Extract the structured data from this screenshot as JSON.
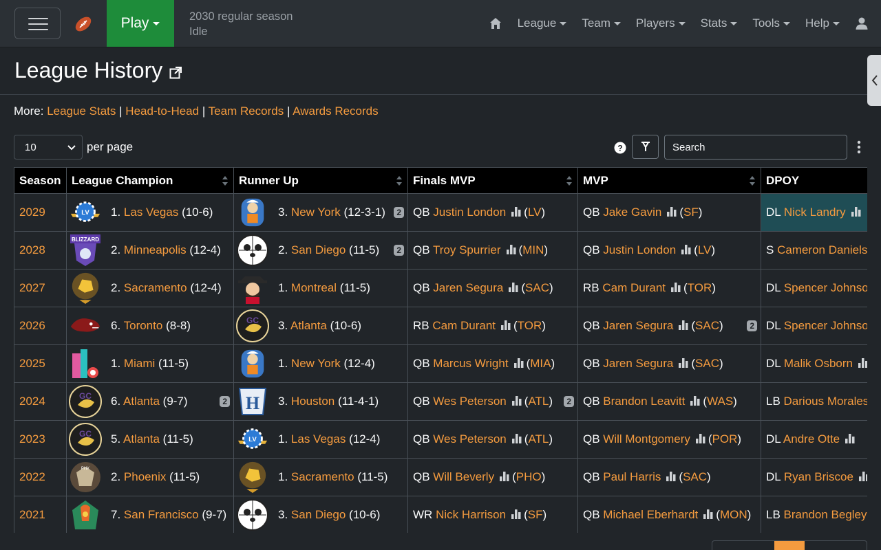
{
  "nav": {
    "play_label": "Play",
    "season": "2030 regular season",
    "status": "Idle",
    "menus": [
      "League",
      "Team",
      "Players",
      "Stats",
      "Tools",
      "Help"
    ]
  },
  "page": {
    "title": "League History"
  },
  "more": {
    "prefix": "More:",
    "links": [
      "League Stats",
      "Head-to-Head",
      "Team Records",
      "Awards Records"
    ],
    "sep": "|"
  },
  "controls": {
    "per_page_value": "10",
    "per_page_label": "per page",
    "search_placeholder": "Search"
  },
  "table": {
    "headers": [
      "Season",
      "League Champion",
      "Runner Up",
      "Finals MVP",
      "MVP",
      "DPOY"
    ],
    "rows": [
      {
        "season": "2029",
        "champ_seed": "1.",
        "champ": "Las Vegas",
        "champ_rec": "(10-6)",
        "champ_badge": "",
        "ru_seed": "3.",
        "ru": "New York",
        "ru_rec": "(12-3-1)",
        "ru_badge": "2",
        "fmvp_pos": "QB",
        "fmvp": "Justin London",
        "fmvp_team": "LV",
        "fmvp_badge": "",
        "mvp_pos": "QB",
        "mvp": "Jake Gavin",
        "mvp_team": "SF",
        "mvp_badge": "",
        "dpoy_pos": "DL",
        "dpoy": "Nick Landry",
        "champ_logo": "lv",
        "ru_logo": "ny"
      },
      {
        "season": "2028",
        "champ_seed": "2.",
        "champ": "Minneapolis",
        "champ_rec": "(12-4)",
        "champ_badge": "",
        "ru_seed": "2.",
        "ru": "San Diego",
        "ru_rec": "(11-5)",
        "ru_badge": "2",
        "fmvp_pos": "QB",
        "fmvp": "Troy Spurrier",
        "fmvp_team": "MIN",
        "fmvp_badge": "",
        "mvp_pos": "QB",
        "mvp": "Justin London",
        "mvp_team": "LV",
        "mvp_badge": "",
        "dpoy_pos": "S",
        "dpoy": "Cameron Daniels",
        "champ_logo": "min",
        "ru_logo": "sd"
      },
      {
        "season": "2027",
        "champ_seed": "2.",
        "champ": "Sacramento",
        "champ_rec": "(12-4)",
        "champ_badge": "",
        "ru_seed": "1.",
        "ru": "Montreal",
        "ru_rec": "(11-5)",
        "ru_badge": "",
        "fmvp_pos": "QB",
        "fmvp": "Jaren Segura",
        "fmvp_team": "SAC",
        "fmvp_badge": "",
        "mvp_pos": "RB",
        "mvp": "Cam Durant",
        "mvp_team": "TOR",
        "mvp_badge": "",
        "dpoy_pos": "DL",
        "dpoy": "Spencer Johnson",
        "champ_logo": "sac",
        "ru_logo": "mon"
      },
      {
        "season": "2026",
        "champ_seed": "6.",
        "champ": "Toronto",
        "champ_rec": "(8-8)",
        "champ_badge": "",
        "ru_seed": "3.",
        "ru": "Atlanta",
        "ru_rec": "(10-6)",
        "ru_badge": "",
        "fmvp_pos": "RB",
        "fmvp": "Cam Durant",
        "fmvp_team": "TOR",
        "fmvp_badge": "",
        "mvp_pos": "QB",
        "mvp": "Jaren Segura",
        "mvp_team": "SAC",
        "mvp_badge": "2",
        "dpoy_pos": "DL",
        "dpoy": "Spencer Johnson",
        "champ_logo": "tor",
        "ru_logo": "atl"
      },
      {
        "season": "2025",
        "champ_seed": "1.",
        "champ": "Miami",
        "champ_rec": "(11-5)",
        "champ_badge": "",
        "ru_seed": "1.",
        "ru": "New York",
        "ru_rec": "(12-4)",
        "ru_badge": "",
        "fmvp_pos": "QB",
        "fmvp": "Marcus Wright",
        "fmvp_team": "MIA",
        "fmvp_badge": "",
        "mvp_pos": "QB",
        "mvp": "Jaren Segura",
        "mvp_team": "SAC",
        "mvp_badge": "",
        "dpoy_pos": "DL",
        "dpoy": "Malik Osborn",
        "champ_logo": "mia",
        "ru_logo": "ny"
      },
      {
        "season": "2024",
        "champ_seed": "6.",
        "champ": "Atlanta",
        "champ_rec": "(9-7)",
        "champ_badge": "2",
        "ru_seed": "3.",
        "ru": "Houston",
        "ru_rec": "(11-4-1)",
        "ru_badge": "",
        "fmvp_pos": "QB",
        "fmvp": "Wes Peterson",
        "fmvp_team": "ATL",
        "fmvp_badge": "2",
        "mvp_pos": "QB",
        "mvp": "Brandon Leavitt",
        "mvp_team": "WAS",
        "mvp_badge": "",
        "dpoy_pos": "LB",
        "dpoy": "Darious Morales",
        "champ_logo": "atl",
        "ru_logo": "hou"
      },
      {
        "season": "2023",
        "champ_seed": "5.",
        "champ": "Atlanta",
        "champ_rec": "(11-5)",
        "champ_badge": "",
        "ru_seed": "1.",
        "ru": "Las Vegas",
        "ru_rec": "(12-4)",
        "ru_badge": "",
        "fmvp_pos": "QB",
        "fmvp": "Wes Peterson",
        "fmvp_team": "ATL",
        "fmvp_badge": "",
        "mvp_pos": "QB",
        "mvp": "Will Montgomery",
        "mvp_team": "POR",
        "mvp_badge": "",
        "dpoy_pos": "DL",
        "dpoy": "Andre Otte",
        "champ_logo": "atl",
        "ru_logo": "lv"
      },
      {
        "season": "2022",
        "champ_seed": "2.",
        "champ": "Phoenix",
        "champ_rec": "(11-5)",
        "champ_badge": "",
        "ru_seed": "1.",
        "ru": "Sacramento",
        "ru_rec": "(11-5)",
        "ru_badge": "",
        "fmvp_pos": "QB",
        "fmvp": "Will Beverly",
        "fmvp_team": "PHO",
        "fmvp_badge": "",
        "mvp_pos": "QB",
        "mvp": "Paul Harris",
        "mvp_team": "SAC",
        "mvp_badge": "",
        "dpoy_pos": "DL",
        "dpoy": "Ryan Briscoe",
        "champ_logo": "pho",
        "ru_logo": "sac"
      },
      {
        "season": "2021",
        "champ_seed": "7.",
        "champ": "San Francisco",
        "champ_rec": "(9-7)",
        "champ_badge": "",
        "ru_seed": "3.",
        "ru": "San Diego",
        "ru_rec": "(10-6)",
        "ru_badge": "",
        "fmvp_pos": "WR",
        "fmvp": "Nick Harrison",
        "fmvp_team": "SF",
        "fmvp_badge": "",
        "mvp_pos": "QB",
        "mvp": "Michael Eberhardt",
        "mvp_team": "MON",
        "mvp_badge": "",
        "dpoy_pos": "LB",
        "dpoy": "Brandon Begley",
        "champ_logo": "sf",
        "ru_logo": "sd"
      }
    ]
  },
  "colors": {
    "accent": "#f49b3f",
    "play": "#1e8c3a",
    "bg": "#212529",
    "highlight": "#1f4d55"
  }
}
